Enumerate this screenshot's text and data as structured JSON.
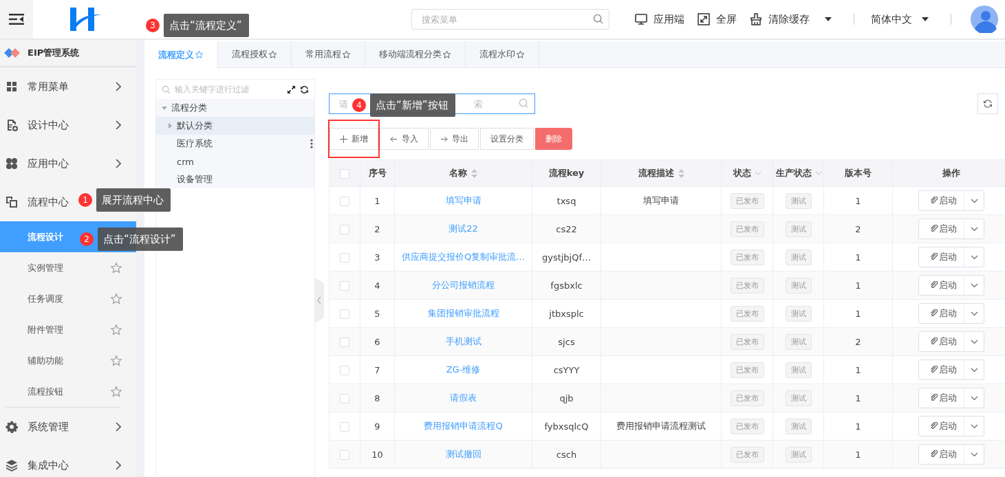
{
  "header": {
    "menu_search": {
      "placeholder": "搜索菜单"
    },
    "actions": [
      {
        "label": "应用端",
        "has_caret": false
      },
      {
        "label": "全屏",
        "has_caret": false
      },
      {
        "label": "清除缓存",
        "has_caret": true
      }
    ],
    "language": "简体中文"
  },
  "sidebar": {
    "title": "EIP管理系统",
    "items": [
      {
        "label": "常用菜单",
        "expanded": false
      },
      {
        "label": "设计中心",
        "expanded": false
      },
      {
        "label": "应用中心",
        "expanded": false
      },
      {
        "label": "流程中心",
        "expanded": true,
        "children": [
          {
            "label": "流程设计",
            "selected": true
          },
          {
            "label": "实例管理",
            "selected": false
          },
          {
            "label": "任务调度",
            "selected": false
          },
          {
            "label": "附件管理",
            "selected": false
          },
          {
            "label": "辅助功能",
            "selected": false
          },
          {
            "label": "流程按钮",
            "selected": false
          }
        ]
      },
      {
        "label": "系统管理",
        "expanded": false
      },
      {
        "label": "集成中心",
        "expanded": false
      }
    ]
  },
  "tabs": [
    {
      "label": "流程定义",
      "selected": true
    },
    {
      "label": "流程授权",
      "selected": false
    },
    {
      "label": "常用流程",
      "selected": false
    },
    {
      "label": "移动端流程分类",
      "selected": false
    },
    {
      "label": "流程水印",
      "selected": false
    }
  ],
  "tree": {
    "filter": {
      "placeholder": "输入关键字进行过滤"
    },
    "root": {
      "label": "流程分类",
      "expanded": true,
      "children": [
        {
          "label": "默认分类",
          "kind": "folder",
          "selected": true,
          "show_menu": false
        },
        {
          "label": "医疗系统",
          "kind": "leaf",
          "selected": false,
          "show_menu": true
        },
        {
          "label": "crm",
          "kind": "leaf",
          "selected": false,
          "show_menu": false
        },
        {
          "label": "设备管理",
          "kind": "leaf",
          "selected": false,
          "show_menu": false
        }
      ]
    }
  },
  "search": {
    "placeholder": "请",
    "placeholder_end": "索"
  },
  "toolbar": [
    {
      "label": "新增",
      "kind": "add",
      "highlighted": true
    },
    {
      "label": "导入",
      "kind": "import",
      "highlighted": false
    },
    {
      "label": "导出",
      "kind": "export",
      "highlighted": false
    },
    {
      "label": "设置分类",
      "kind": "plain",
      "highlighted": false
    },
    {
      "label": "删除",
      "kind": "danger",
      "highlighted": false
    }
  ],
  "table": {
    "select_all": {
      "checked": false
    },
    "columns": [
      {
        "label": "序号",
        "sortable": false,
        "filterable": false
      },
      {
        "label": "名称",
        "sortable": true,
        "filterable": false
      },
      {
        "label": "流程key",
        "sortable": false,
        "filterable": false
      },
      {
        "label": "流程描述",
        "sortable": true,
        "filterable": false
      },
      {
        "label": "状态",
        "sortable": false,
        "filterable": true
      },
      {
        "label": "生产状态",
        "sortable": false,
        "filterable": true
      },
      {
        "label": "版本号",
        "sortable": false,
        "filterable": false
      },
      {
        "label": "操作",
        "sortable": false,
        "filterable": false
      }
    ],
    "rows": [
      {
        "checked": false,
        "index": "1",
        "name": "填写申请",
        "key": "txsq",
        "description": "填写申请",
        "status": "已发布",
        "production_status": "测试",
        "version": "1",
        "action": "启动"
      },
      {
        "checked": false,
        "index": "2",
        "name": "测试22",
        "key": "cs22",
        "description": "",
        "status": "已发布",
        "production_status": "测试",
        "version": "2",
        "action": "启动"
      },
      {
        "checked": false,
        "index": "3",
        "name": "供应商提交报价Q复制审批流…",
        "key": "gystjbjQf…",
        "description": "",
        "status": "已发布",
        "production_status": "测试",
        "version": "1",
        "action": "启动"
      },
      {
        "checked": false,
        "index": "4",
        "name": "分公司报销流程",
        "key": "fgsbxlc",
        "description": "",
        "status": "已发布",
        "production_status": "测试",
        "version": "1",
        "action": "启动"
      },
      {
        "checked": false,
        "index": "5",
        "name": "集团报销审批流程",
        "key": "jtbxsplc",
        "description": "",
        "status": "已发布",
        "production_status": "测试",
        "version": "1",
        "action": "启动"
      },
      {
        "checked": false,
        "index": "6",
        "name": "手机测试",
        "key": "sjcs",
        "description": "",
        "status": "已发布",
        "production_status": "测试",
        "version": "2",
        "action": "启动"
      },
      {
        "checked": false,
        "index": "7",
        "name": "ZG-维修",
        "key": "csYYY",
        "description": "",
        "status": "已发布",
        "production_status": "测试",
        "version": "1",
        "action": "启动"
      },
      {
        "checked": false,
        "index": "8",
        "name": "请假表",
        "key": "qjb",
        "description": "",
        "status": "已发布",
        "production_status": "测试",
        "version": "1",
        "action": "启动"
      },
      {
        "checked": false,
        "index": "9",
        "name": "费用报销申请流程Q",
        "key": "fybxsqlcQ",
        "description": "费用报销申请流程测试",
        "status": "已发布",
        "production_status": "测试",
        "version": "1",
        "action": "启动"
      },
      {
        "checked": false,
        "index": "10",
        "name": "测试撤回",
        "key": "csch",
        "description": "",
        "status": "已发布",
        "production_status": "测试",
        "version": "1",
        "action": "启动"
      }
    ]
  },
  "annotations": [
    {
      "number": "3",
      "text": "点击“流程定义”"
    },
    {
      "number": "4",
      "text": "点击“新增”按钮"
    },
    {
      "number": "1",
      "text": "展开流程中心"
    },
    {
      "number": "2",
      "text": "点击“流程设计”"
    }
  ]
}
